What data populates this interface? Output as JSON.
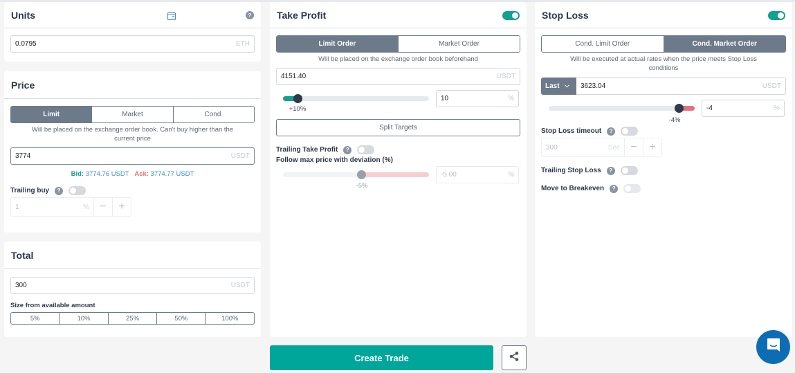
{
  "units": {
    "title": "Units",
    "wallet_icon": "wallet-icon",
    "help_icon": "question-icon",
    "value": "0.0795",
    "unit": "ETH"
  },
  "price": {
    "title": "Price",
    "tabs": [
      {
        "label": "Limit",
        "active": true
      },
      {
        "label": "Market",
        "active": false
      },
      {
        "label": "Cond.",
        "active": false
      }
    ],
    "hint": "Will be placed on the exchange order book. Can't buy higher than the current price",
    "value": "3774",
    "unit": "USDT",
    "bid_label": "Bid:",
    "bid_value": "3774.76 USDT",
    "ask_label": "Ask:",
    "ask_value": "3774.77 USDT",
    "trailing_buy": {
      "label": "Trailing buy",
      "enabled": false,
      "value": "1",
      "unit": "%",
      "minus": "−",
      "plus": "+"
    }
  },
  "total": {
    "title": "Total",
    "value": "300",
    "unit": "USDT",
    "size_label": "Size from available amount",
    "size_options": [
      "5%",
      "10%",
      "25%",
      "50%",
      "100%"
    ]
  },
  "take_profit": {
    "title": "Take Profit",
    "enabled": true,
    "tabs": [
      {
        "label": "Limit Order",
        "active": true
      },
      {
        "label": "Market Order",
        "active": false
      }
    ],
    "hint": "Will be placed on the exchange order book beforehand",
    "price_value": "4151.40",
    "price_unit": "USDT",
    "slider_label": "+10%",
    "slider_percent": 10,
    "percent_value": "10",
    "percent_unit": "%",
    "split_targets_label": "Split Targets",
    "trailing_label": "Trailing Take Profit",
    "trailing_enabled": false,
    "deviation_label": "Follow max price with deviation (%)",
    "deviation_slider_label": "-5%",
    "deviation_value": "-5.00",
    "deviation_unit": "%"
  },
  "stop_loss": {
    "title": "Stop Loss",
    "enabled": true,
    "tabs": [
      {
        "label": "Cond. Limit Order",
        "active": false
      },
      {
        "label": "Cond. Market Order",
        "active": true
      }
    ],
    "hint": "Will be executed at actual rates when the price meets Stop Loss conditions",
    "price_type": "Last",
    "price_value": "3623.04",
    "price_unit": "USDT",
    "slider_label": "-4%",
    "percent_value": "-4",
    "percent_unit": "%",
    "timeout_label": "Stop Loss timeout",
    "timeout_enabled": false,
    "timeout_value": "300",
    "timeout_unit": "Sec",
    "minus": "−",
    "plus": "+",
    "trailing_label": "Trailing Stop Loss",
    "trailing_enabled": false,
    "breakeven_label": "Move to Breakeven",
    "breakeven_enabled": false
  },
  "actions": {
    "create_trade_label": "Create Trade",
    "share_icon": "share-icon",
    "chat_icon": "chat-icon"
  },
  "colors": {
    "accent": "#00a69a",
    "segment_active": "#6c7a89",
    "bid": "#14a095",
    "ask": "#e5707a",
    "stop_fill": "#e5707a",
    "chat": "#0c6db4"
  }
}
